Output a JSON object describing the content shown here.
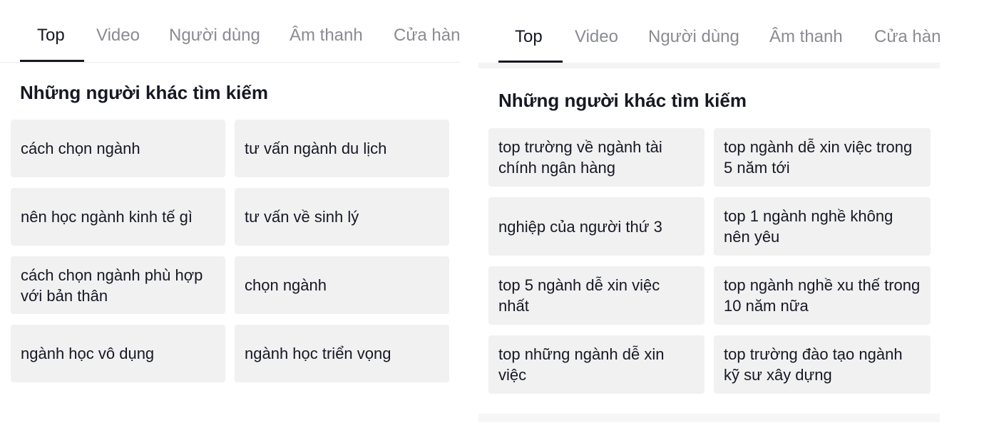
{
  "left": {
    "tabs": [
      {
        "label": "Top",
        "active": true
      },
      {
        "label": "Video"
      },
      {
        "label": "Người dùng"
      },
      {
        "label": "Âm thanh"
      },
      {
        "label": "Cửa hàn"
      }
    ],
    "heading": "Những người khác tìm kiếm",
    "suggestions": [
      "cách chọn ngành",
      "tư vấn ngành du lịch",
      "nên học ngành kinh tế gì",
      "tư vấn về sinh lý",
      "cách chọn ngành phù hợp với bản thân",
      "chọn ngành",
      "ngành học vô dụng",
      "ngành học triển vọng"
    ]
  },
  "right": {
    "tabs": [
      {
        "label": "Top",
        "active": true
      },
      {
        "label": "Video"
      },
      {
        "label": "Người dùng"
      },
      {
        "label": "Âm thanh"
      },
      {
        "label": "Cửa hàn"
      }
    ],
    "heading": "Những người khác tìm kiếm",
    "suggestions": [
      "top trường về ngành tài chính ngân hàng",
      "top ngành dễ xin việc trong 5 năm tới",
      "nghiệp của người thứ 3",
      "top 1 ngành nghề không nên yêu",
      "top 5 ngành dễ xin việc nhất",
      "top ngành nghề xu thế trong 10 năm nữa",
      "top những ngành dễ xin việc",
      "top trường đào tạo ngành kỹ sư xây dựng"
    ]
  },
  "colors": {
    "text": "#161823",
    "inactive_tab": "#8a8b91",
    "card_bg": "#f1f1f2"
  }
}
